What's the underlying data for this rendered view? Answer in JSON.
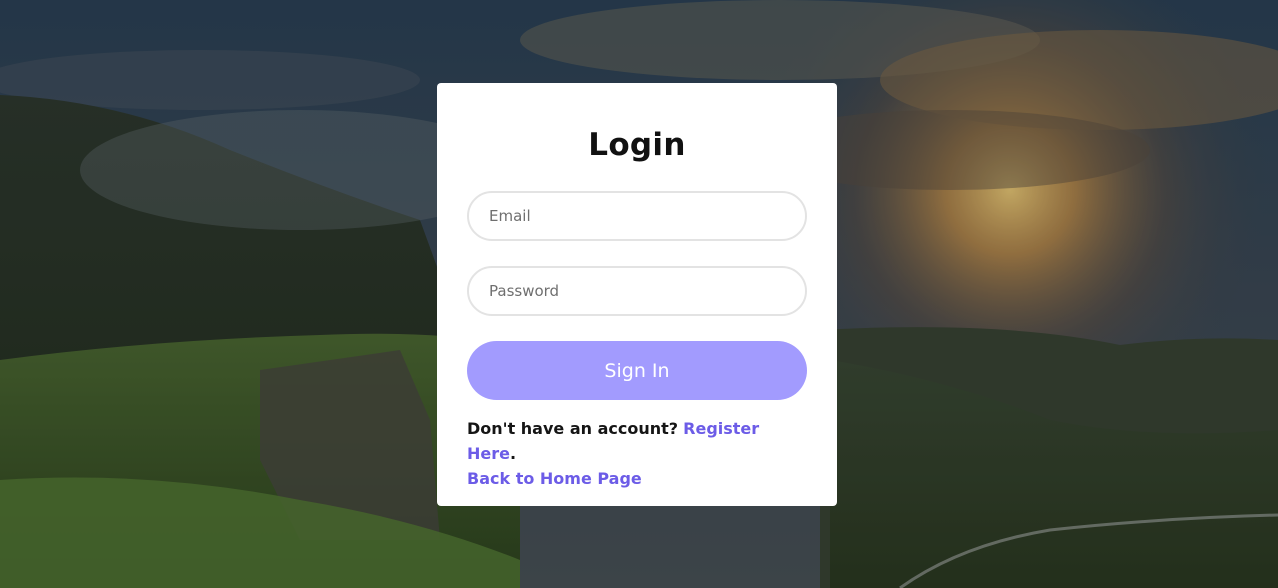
{
  "login": {
    "title": "Login",
    "email_placeholder": "Email",
    "password_placeholder": "Password",
    "signin_label": "Sign In",
    "no_account_text": "Don't have an account?",
    "register_link": "Register Here",
    "period": ".",
    "home_link": "Back to Home Page"
  },
  "colors": {
    "accent": "#6c5ce7",
    "button": "#a29bfe",
    "card": "#ffffff"
  }
}
